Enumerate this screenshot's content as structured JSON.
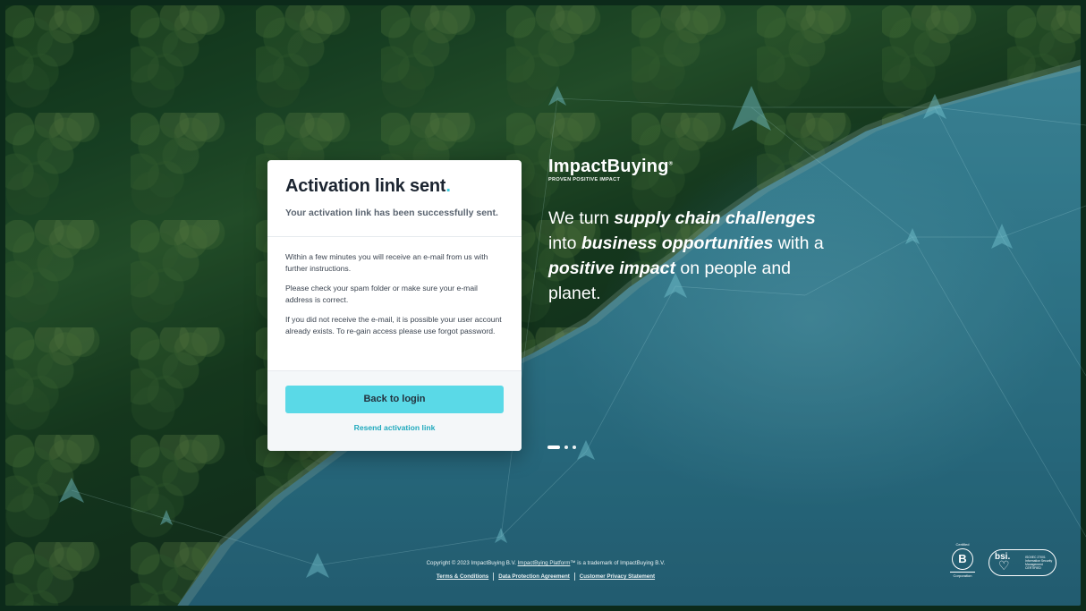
{
  "card": {
    "title": "Activation link sent",
    "title_dot": ".",
    "subtitle": "Your activation link has been successfully sent.",
    "paragraphs": [
      "Within a few minutes you will receive an e-mail from us with further instructions.",
      "Please check your spam folder or make sure your e-mail address is correct.",
      "If you did not receive the e-mail, it is possible your user account already exists. To re-gain access please use forgot password."
    ],
    "primary_button": "Back to login",
    "resend_link": "Resend activation link"
  },
  "brand": {
    "name": "ImpactBuying",
    "trademark": "®",
    "tagline_small": "PROVEN POSITIVE IMPACT"
  },
  "hero": {
    "text_1": "We turn ",
    "bold_1": "supply chain challenges",
    "text_2": " into ",
    "bold_2": "business opportunities",
    "text_3": " with a ",
    "bold_3": "positive impact",
    "text_4": " on people and planet."
  },
  "carousel": {
    "slides": 3,
    "active": 1
  },
  "footer": {
    "copyright_prefix": "Copyright © 2023 ImpactBuying B.V. ",
    "platform_link": "ImpactBying Platform",
    "copyright_suffix": "™ is a trademark of ImpactBuying B.V.",
    "links": [
      "Terms & Conditions",
      "Data Protection Agreement",
      "Customer Privacy Statement"
    ]
  },
  "badges": {
    "bcorp_top": "Certified",
    "bcorp_letter": "B",
    "bcorp_bottom": "Corporation",
    "bsi_logo": "bsi.",
    "bsi_text": "ISO/IEC 27001 Information Security Management CERTIFIED"
  },
  "colors": {
    "accent": "#5ad9e7",
    "link": "#1fa9bd",
    "title_dot": "#2cc6da"
  }
}
